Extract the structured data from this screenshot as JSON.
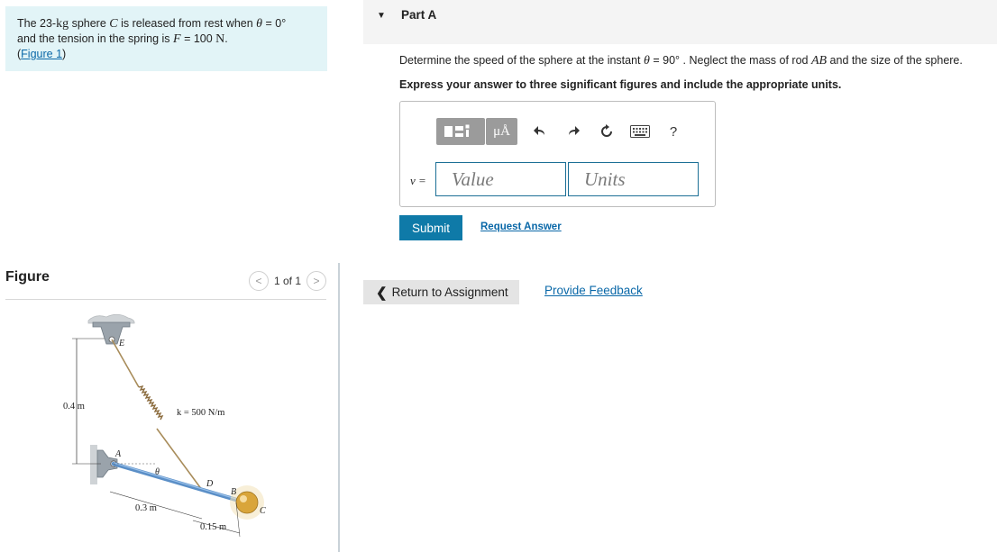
{
  "problem": {
    "text_1": "The 23-",
    "kg": "kg",
    "text_2": " sphere ",
    "var_c": "C",
    "text_3": " is released from rest when ",
    "theta": "θ",
    "text_4": " = 0°",
    "text_5": "and the tension in the spring is ",
    "var_f": "F",
    "text_6": " = 100 ",
    "unit_n": "N",
    "text_7": ".",
    "figure_link": "Figure 1",
    "paren_open": "(",
    "paren_close": ")"
  },
  "figure": {
    "title": "Figure",
    "pager_text": "1 of 1",
    "prev_glyph": "<",
    "next_glyph": ">",
    "labels": {
      "E": "E",
      "A": "A",
      "D": "D",
      "B": "B",
      "C": "C",
      "theta": "θ",
      "height": "0.4 m",
      "spring": "k = 500 N/m",
      "len_ad": "0.3 m",
      "len_db": "0.15 m"
    }
  },
  "part": {
    "caret": "▼",
    "title": "Part A",
    "question_1": "Determine the speed of the sphere at the instant ",
    "theta": "θ",
    "question_2": " = 90°  . Neglect the mass of rod ",
    "rod": "AB",
    "question_3": " and the size of the sphere.",
    "instruction": "Express your answer to three significant figures and include the appropriate units."
  },
  "answer": {
    "mu_label": "μÅ",
    "help_label": "?",
    "var_label": "v =",
    "value_placeholder": "Value",
    "units_placeholder": "Units"
  },
  "actions": {
    "submit": "Submit",
    "request_answer": "Request Answer",
    "return": "Return to Assignment",
    "return_chevron": "❮",
    "feedback": "Provide Feedback"
  },
  "colors": {
    "intro_bg": "#e2f4f7",
    "link": "#0a68a8",
    "submit_bg": "#0f7aa8",
    "input_border": "#1c6f96",
    "rod": "#5b8fc7",
    "sphere": "#d9a53a"
  }
}
